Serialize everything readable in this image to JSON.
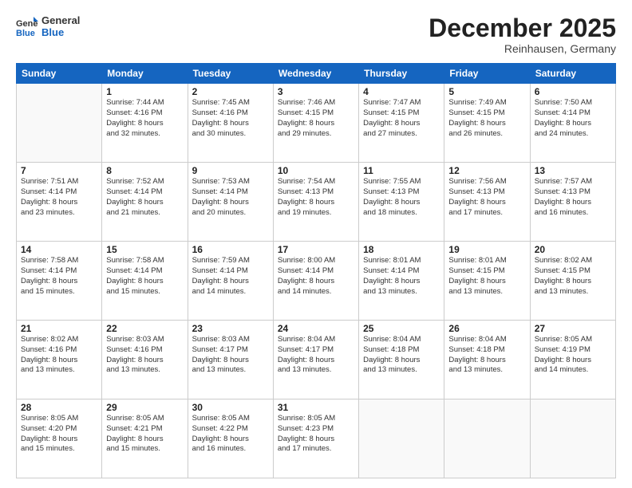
{
  "header": {
    "logo_general": "General",
    "logo_blue": "Blue",
    "month_title": "December 2025",
    "location": "Reinhausen, Germany"
  },
  "weekdays": [
    "Sunday",
    "Monday",
    "Tuesday",
    "Wednesday",
    "Thursday",
    "Friday",
    "Saturday"
  ],
  "weeks": [
    [
      {
        "day": "",
        "info": ""
      },
      {
        "day": "1",
        "info": "Sunrise: 7:44 AM\nSunset: 4:16 PM\nDaylight: 8 hours\nand 32 minutes."
      },
      {
        "day": "2",
        "info": "Sunrise: 7:45 AM\nSunset: 4:16 PM\nDaylight: 8 hours\nand 30 minutes."
      },
      {
        "day": "3",
        "info": "Sunrise: 7:46 AM\nSunset: 4:15 PM\nDaylight: 8 hours\nand 29 minutes."
      },
      {
        "day": "4",
        "info": "Sunrise: 7:47 AM\nSunset: 4:15 PM\nDaylight: 8 hours\nand 27 minutes."
      },
      {
        "day": "5",
        "info": "Sunrise: 7:49 AM\nSunset: 4:15 PM\nDaylight: 8 hours\nand 26 minutes."
      },
      {
        "day": "6",
        "info": "Sunrise: 7:50 AM\nSunset: 4:14 PM\nDaylight: 8 hours\nand 24 minutes."
      }
    ],
    [
      {
        "day": "7",
        "info": "Sunrise: 7:51 AM\nSunset: 4:14 PM\nDaylight: 8 hours\nand 23 minutes."
      },
      {
        "day": "8",
        "info": "Sunrise: 7:52 AM\nSunset: 4:14 PM\nDaylight: 8 hours\nand 21 minutes."
      },
      {
        "day": "9",
        "info": "Sunrise: 7:53 AM\nSunset: 4:14 PM\nDaylight: 8 hours\nand 20 minutes."
      },
      {
        "day": "10",
        "info": "Sunrise: 7:54 AM\nSunset: 4:13 PM\nDaylight: 8 hours\nand 19 minutes."
      },
      {
        "day": "11",
        "info": "Sunrise: 7:55 AM\nSunset: 4:13 PM\nDaylight: 8 hours\nand 18 minutes."
      },
      {
        "day": "12",
        "info": "Sunrise: 7:56 AM\nSunset: 4:13 PM\nDaylight: 8 hours\nand 17 minutes."
      },
      {
        "day": "13",
        "info": "Sunrise: 7:57 AM\nSunset: 4:13 PM\nDaylight: 8 hours\nand 16 minutes."
      }
    ],
    [
      {
        "day": "14",
        "info": "Sunrise: 7:58 AM\nSunset: 4:14 PM\nDaylight: 8 hours\nand 15 minutes."
      },
      {
        "day": "15",
        "info": "Sunrise: 7:58 AM\nSunset: 4:14 PM\nDaylight: 8 hours\nand 15 minutes."
      },
      {
        "day": "16",
        "info": "Sunrise: 7:59 AM\nSunset: 4:14 PM\nDaylight: 8 hours\nand 14 minutes."
      },
      {
        "day": "17",
        "info": "Sunrise: 8:00 AM\nSunset: 4:14 PM\nDaylight: 8 hours\nand 14 minutes."
      },
      {
        "day": "18",
        "info": "Sunrise: 8:01 AM\nSunset: 4:14 PM\nDaylight: 8 hours\nand 13 minutes."
      },
      {
        "day": "19",
        "info": "Sunrise: 8:01 AM\nSunset: 4:15 PM\nDaylight: 8 hours\nand 13 minutes."
      },
      {
        "day": "20",
        "info": "Sunrise: 8:02 AM\nSunset: 4:15 PM\nDaylight: 8 hours\nand 13 minutes."
      }
    ],
    [
      {
        "day": "21",
        "info": "Sunrise: 8:02 AM\nSunset: 4:16 PM\nDaylight: 8 hours\nand 13 minutes."
      },
      {
        "day": "22",
        "info": "Sunrise: 8:03 AM\nSunset: 4:16 PM\nDaylight: 8 hours\nand 13 minutes."
      },
      {
        "day": "23",
        "info": "Sunrise: 8:03 AM\nSunset: 4:17 PM\nDaylight: 8 hours\nand 13 minutes."
      },
      {
        "day": "24",
        "info": "Sunrise: 8:04 AM\nSunset: 4:17 PM\nDaylight: 8 hours\nand 13 minutes."
      },
      {
        "day": "25",
        "info": "Sunrise: 8:04 AM\nSunset: 4:18 PM\nDaylight: 8 hours\nand 13 minutes."
      },
      {
        "day": "26",
        "info": "Sunrise: 8:04 AM\nSunset: 4:18 PM\nDaylight: 8 hours\nand 13 minutes."
      },
      {
        "day": "27",
        "info": "Sunrise: 8:05 AM\nSunset: 4:19 PM\nDaylight: 8 hours\nand 14 minutes."
      }
    ],
    [
      {
        "day": "28",
        "info": "Sunrise: 8:05 AM\nSunset: 4:20 PM\nDaylight: 8 hours\nand 15 minutes."
      },
      {
        "day": "29",
        "info": "Sunrise: 8:05 AM\nSunset: 4:21 PM\nDaylight: 8 hours\nand 15 minutes."
      },
      {
        "day": "30",
        "info": "Sunrise: 8:05 AM\nSunset: 4:22 PM\nDaylight: 8 hours\nand 16 minutes."
      },
      {
        "day": "31",
        "info": "Sunrise: 8:05 AM\nSunset: 4:23 PM\nDaylight: 8 hours\nand 17 minutes."
      },
      {
        "day": "",
        "info": ""
      },
      {
        "day": "",
        "info": ""
      },
      {
        "day": "",
        "info": ""
      }
    ]
  ]
}
